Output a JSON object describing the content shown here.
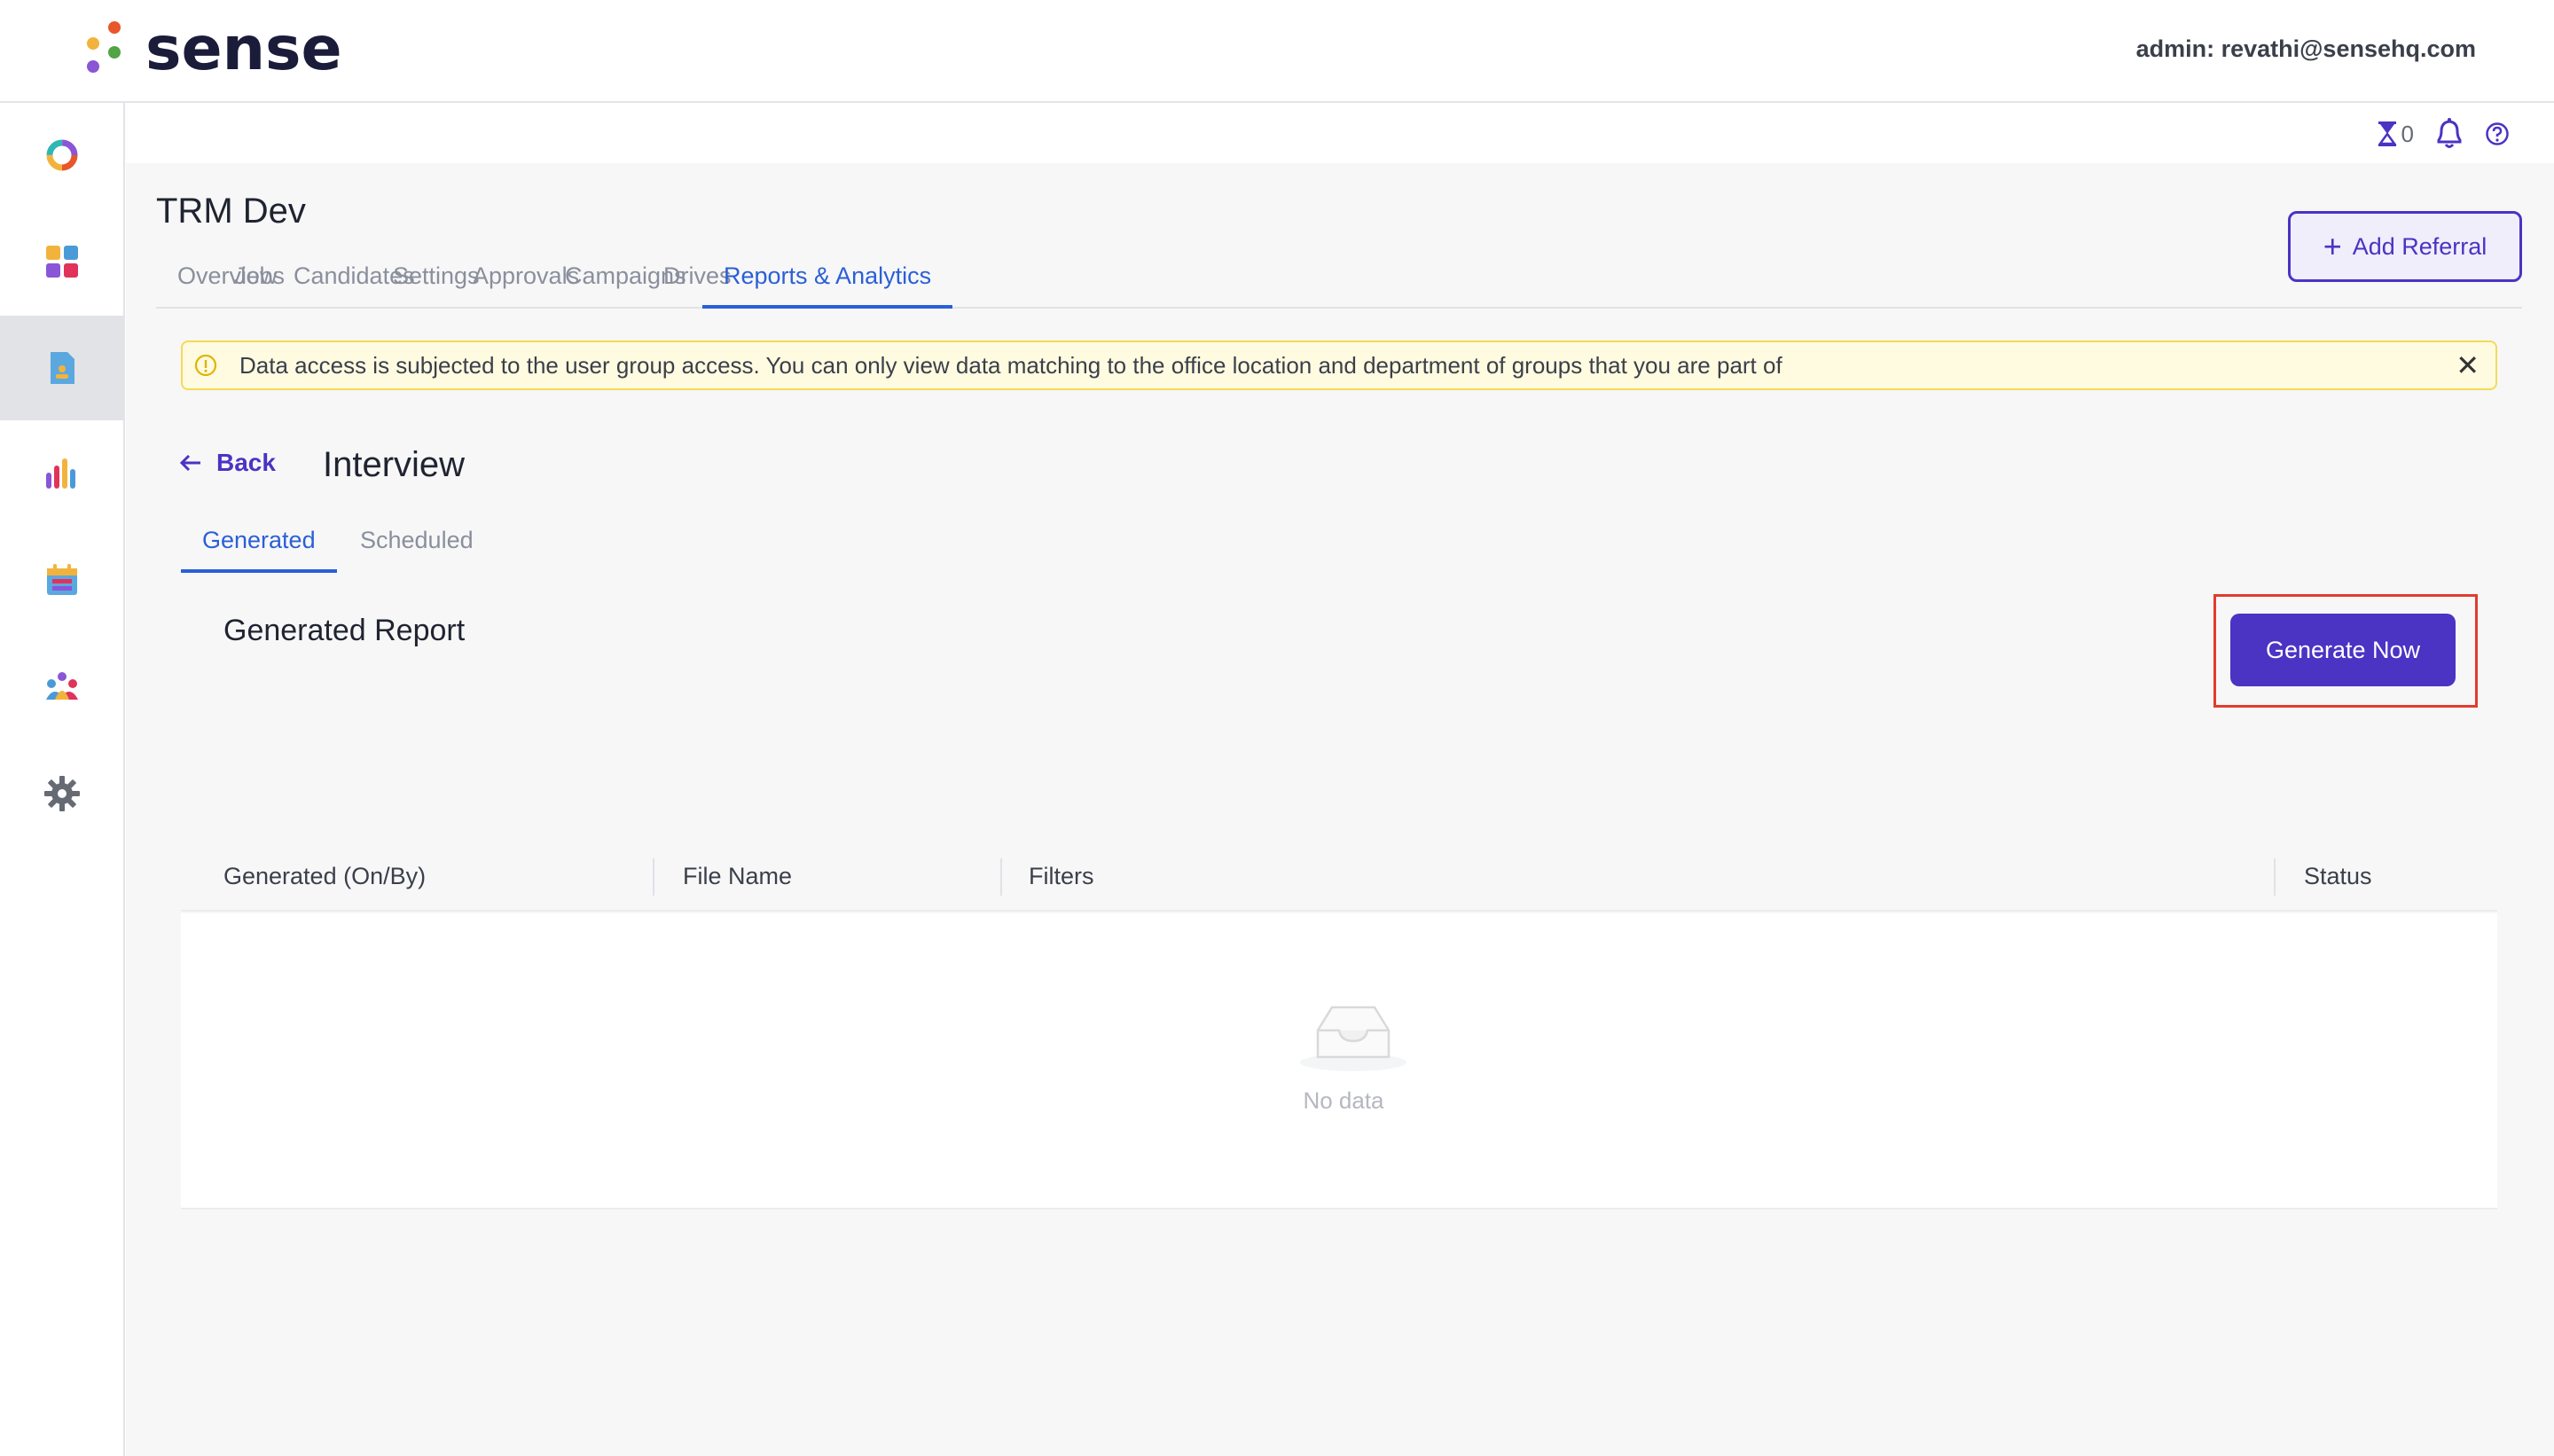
{
  "header": {
    "brand": "sense",
    "admin_label": "admin: revathi@sensehq.com"
  },
  "util": {
    "pending_count": "0"
  },
  "project": {
    "title": "TRM Dev",
    "add_referral_label": "Add Referral"
  },
  "tabs": [
    {
      "label": "Overview"
    },
    {
      "label": "Jobs"
    },
    {
      "label": "Candidates"
    },
    {
      "label": "Settings"
    },
    {
      "label": "Approvals"
    },
    {
      "label": "Campaigns"
    },
    {
      "label": "Drives"
    },
    {
      "label": "Reports & Analytics"
    }
  ],
  "active_tab": "Reports & Analytics",
  "banner": {
    "message": "Data access is subjected to the user group access. You can only view data matching to the office location and department of groups that you are part of",
    "close": "✕"
  },
  "page": {
    "back_label": "Back",
    "title": "Interview"
  },
  "subtabs": [
    {
      "label": "Generated"
    },
    {
      "label": "Scheduled"
    }
  ],
  "active_subtab": "Generated",
  "report": {
    "title": "Generated Report",
    "generate_label": "Generate Now"
  },
  "table": {
    "columns": [
      "Generated (On/By)",
      "File Name",
      "Filters",
      "Status"
    ],
    "empty_text": "No data"
  },
  "colors": {
    "primary": "#4b33c4",
    "tab_active": "#2a5fd6",
    "banner_bg": "#fffbe0",
    "banner_border": "#f3db57",
    "highlight": "#e23b2e"
  },
  "icons": {
    "sidebar": [
      "donut-icon",
      "dashboard-icon",
      "report-icon",
      "analytics-icon",
      "calendar-icon",
      "team-icon",
      "settings-icon"
    ],
    "util": [
      "hourglass-icon",
      "bell-icon",
      "help-icon"
    ]
  }
}
